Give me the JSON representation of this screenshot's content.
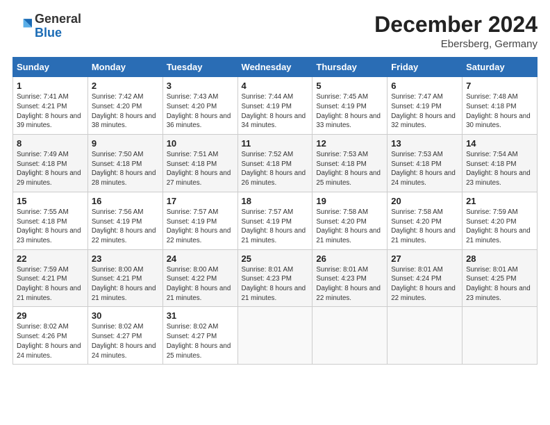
{
  "header": {
    "logo_general": "General",
    "logo_blue": "Blue",
    "month_title": "December 2024",
    "location": "Ebersberg, Germany"
  },
  "calendar": {
    "days_of_week": [
      "Sunday",
      "Monday",
      "Tuesday",
      "Wednesday",
      "Thursday",
      "Friday",
      "Saturday"
    ],
    "weeks": [
      [
        {
          "day": "1",
          "sunrise": "7:41 AM",
          "sunset": "4:21 PM",
          "daylight": "8 hours and 39 minutes."
        },
        {
          "day": "2",
          "sunrise": "7:42 AM",
          "sunset": "4:20 PM",
          "daylight": "8 hours and 38 minutes."
        },
        {
          "day": "3",
          "sunrise": "7:43 AM",
          "sunset": "4:20 PM",
          "daylight": "8 hours and 36 minutes."
        },
        {
          "day": "4",
          "sunrise": "7:44 AM",
          "sunset": "4:19 PM",
          "daylight": "8 hours and 34 minutes."
        },
        {
          "day": "5",
          "sunrise": "7:45 AM",
          "sunset": "4:19 PM",
          "daylight": "8 hours and 33 minutes."
        },
        {
          "day": "6",
          "sunrise": "7:47 AM",
          "sunset": "4:19 PM",
          "daylight": "8 hours and 32 minutes."
        },
        {
          "day": "7",
          "sunrise": "7:48 AM",
          "sunset": "4:18 PM",
          "daylight": "8 hours and 30 minutes."
        }
      ],
      [
        {
          "day": "8",
          "sunrise": "7:49 AM",
          "sunset": "4:18 PM",
          "daylight": "8 hours and 29 minutes."
        },
        {
          "day": "9",
          "sunrise": "7:50 AM",
          "sunset": "4:18 PM",
          "daylight": "8 hours and 28 minutes."
        },
        {
          "day": "10",
          "sunrise": "7:51 AM",
          "sunset": "4:18 PM",
          "daylight": "8 hours and 27 minutes."
        },
        {
          "day": "11",
          "sunrise": "7:52 AM",
          "sunset": "4:18 PM",
          "daylight": "8 hours and 26 minutes."
        },
        {
          "day": "12",
          "sunrise": "7:53 AM",
          "sunset": "4:18 PM",
          "daylight": "8 hours and 25 minutes."
        },
        {
          "day": "13",
          "sunrise": "7:53 AM",
          "sunset": "4:18 PM",
          "daylight": "8 hours and 24 minutes."
        },
        {
          "day": "14",
          "sunrise": "7:54 AM",
          "sunset": "4:18 PM",
          "daylight": "8 hours and 23 minutes."
        }
      ],
      [
        {
          "day": "15",
          "sunrise": "7:55 AM",
          "sunset": "4:18 PM",
          "daylight": "8 hours and 23 minutes."
        },
        {
          "day": "16",
          "sunrise": "7:56 AM",
          "sunset": "4:19 PM",
          "daylight": "8 hours and 22 minutes."
        },
        {
          "day": "17",
          "sunrise": "7:57 AM",
          "sunset": "4:19 PM",
          "daylight": "8 hours and 22 minutes."
        },
        {
          "day": "18",
          "sunrise": "7:57 AM",
          "sunset": "4:19 PM",
          "daylight": "8 hours and 21 minutes."
        },
        {
          "day": "19",
          "sunrise": "7:58 AM",
          "sunset": "4:20 PM",
          "daylight": "8 hours and 21 minutes."
        },
        {
          "day": "20",
          "sunrise": "7:58 AM",
          "sunset": "4:20 PM",
          "daylight": "8 hours and 21 minutes."
        },
        {
          "day": "21",
          "sunrise": "7:59 AM",
          "sunset": "4:20 PM",
          "daylight": "8 hours and 21 minutes."
        }
      ],
      [
        {
          "day": "22",
          "sunrise": "7:59 AM",
          "sunset": "4:21 PM",
          "daylight": "8 hours and 21 minutes."
        },
        {
          "day": "23",
          "sunrise": "8:00 AM",
          "sunset": "4:21 PM",
          "daylight": "8 hours and 21 minutes."
        },
        {
          "day": "24",
          "sunrise": "8:00 AM",
          "sunset": "4:22 PM",
          "daylight": "8 hours and 21 minutes."
        },
        {
          "day": "25",
          "sunrise": "8:01 AM",
          "sunset": "4:23 PM",
          "daylight": "8 hours and 21 minutes."
        },
        {
          "day": "26",
          "sunrise": "8:01 AM",
          "sunset": "4:23 PM",
          "daylight": "8 hours and 22 minutes."
        },
        {
          "day": "27",
          "sunrise": "8:01 AM",
          "sunset": "4:24 PM",
          "daylight": "8 hours and 22 minutes."
        },
        {
          "day": "28",
          "sunrise": "8:01 AM",
          "sunset": "4:25 PM",
          "daylight": "8 hours and 23 minutes."
        }
      ],
      [
        {
          "day": "29",
          "sunrise": "8:02 AM",
          "sunset": "4:26 PM",
          "daylight": "8 hours and 24 minutes."
        },
        {
          "day": "30",
          "sunrise": "8:02 AM",
          "sunset": "4:27 PM",
          "daylight": "8 hours and 24 minutes."
        },
        {
          "day": "31",
          "sunrise": "8:02 AM",
          "sunset": "4:27 PM",
          "daylight": "8 hours and 25 minutes."
        },
        null,
        null,
        null,
        null
      ]
    ],
    "labels": {
      "sunrise": "Sunrise:",
      "sunset": "Sunset:",
      "daylight": "Daylight:"
    }
  }
}
